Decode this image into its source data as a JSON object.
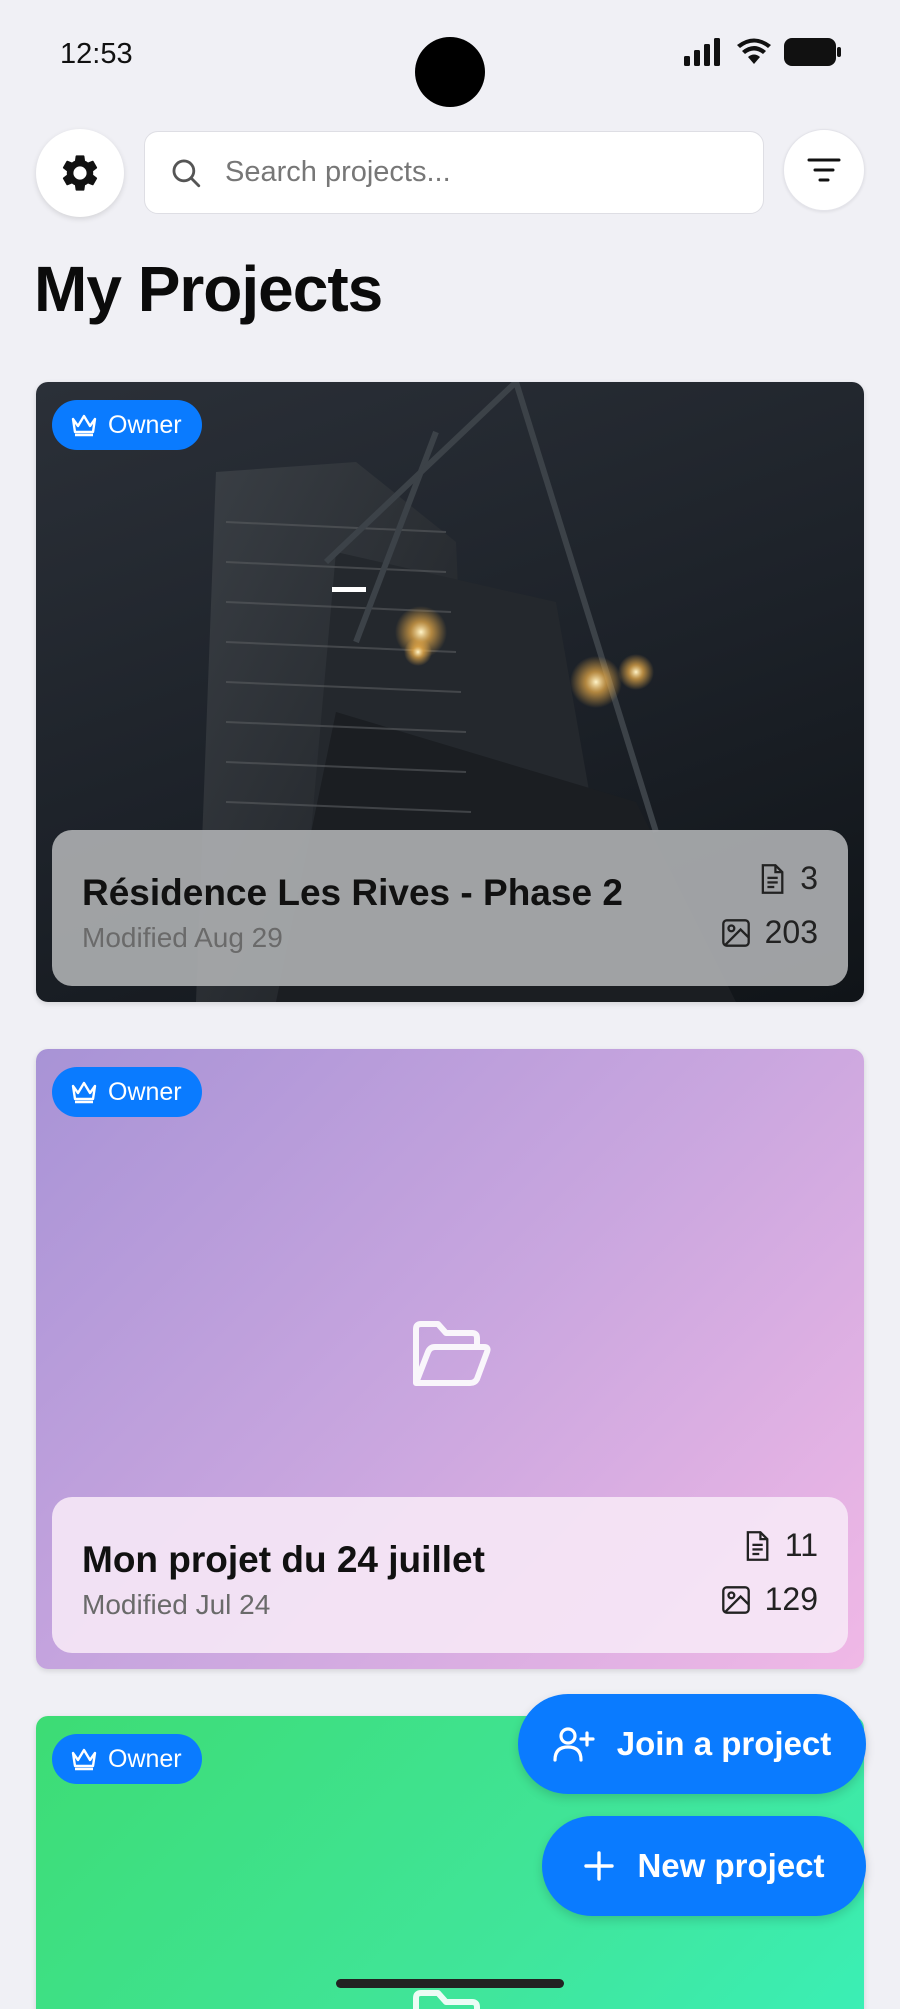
{
  "status_bar": {
    "time": "12:53"
  },
  "search": {
    "placeholder": "Search projects..."
  },
  "page": {
    "title": "My Projects"
  },
  "badge_label": "Owner",
  "projects": [
    {
      "name": "Résidence Les Rives - Phase 2",
      "modified": "Modified Aug 29",
      "documents": "3",
      "photos": "203"
    },
    {
      "name": "Mon projet du 24 juillet",
      "modified": "Modified Jul 24",
      "documents": "11",
      "photos": "129"
    },
    {
      "name": "",
      "modified": "",
      "documents": "",
      "photos": ""
    }
  ],
  "actions": {
    "join_label": "Join a project",
    "new_label": "New project"
  },
  "colors": {
    "accent": "#0a7bff",
    "background": "#f0f0f5"
  }
}
